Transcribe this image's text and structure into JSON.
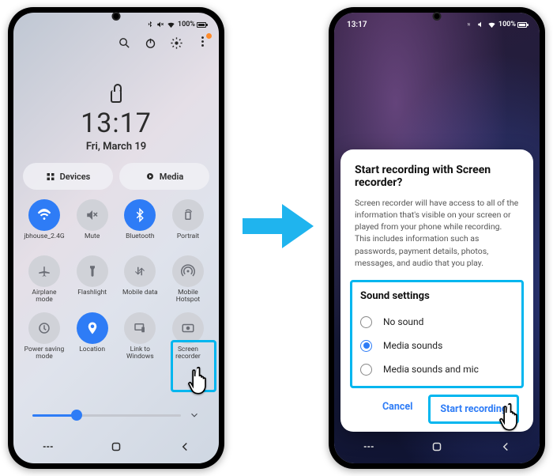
{
  "left": {
    "status": {
      "time": "",
      "battery_pct": "100%"
    },
    "clock": {
      "time": "13:17",
      "date": "Fri, March 19"
    },
    "pills": {
      "devices": "Devices",
      "media": "Media"
    },
    "tiles": [
      {
        "id": "wifi",
        "label": "jbhouse_2.4G",
        "on": true
      },
      {
        "id": "mute",
        "label": "Mute",
        "on": false
      },
      {
        "id": "bluetooth",
        "label": "Bluetooth",
        "on": true
      },
      {
        "id": "portrait",
        "label": "Portrait",
        "on": false
      },
      {
        "id": "airplane",
        "label": "Airplane mode",
        "on": false
      },
      {
        "id": "flashlight",
        "label": "Flashlight",
        "on": false
      },
      {
        "id": "mobiledata",
        "label": "Mobile data",
        "on": false
      },
      {
        "id": "hotspot",
        "label": "Mobile Hotspot",
        "on": false
      },
      {
        "id": "powersave",
        "label": "Power saving mode",
        "on": false
      },
      {
        "id": "location",
        "label": "Location",
        "on": true
      },
      {
        "id": "linkwin",
        "label": "Link to Windows",
        "on": false
      },
      {
        "id": "screenrec",
        "label": "Screen recorder",
        "on": false
      }
    ],
    "slider_pct": 30
  },
  "right": {
    "status": {
      "time": "13:17",
      "battery_pct": "100%"
    },
    "dialog": {
      "title": "Start recording with Screen recorder?",
      "body": "Screen recorder will have access to all of the information that's visible on your screen or played from your phone while recording. This includes information such as passwords, payment details, photos, messages, and audio that you play.",
      "sound_title": "Sound settings",
      "options": [
        {
          "label": "No sound",
          "selected": false
        },
        {
          "label": "Media sounds",
          "selected": true
        },
        {
          "label": "Media sounds and mic",
          "selected": false
        }
      ],
      "cancel": "Cancel",
      "start": "Start recording"
    }
  }
}
